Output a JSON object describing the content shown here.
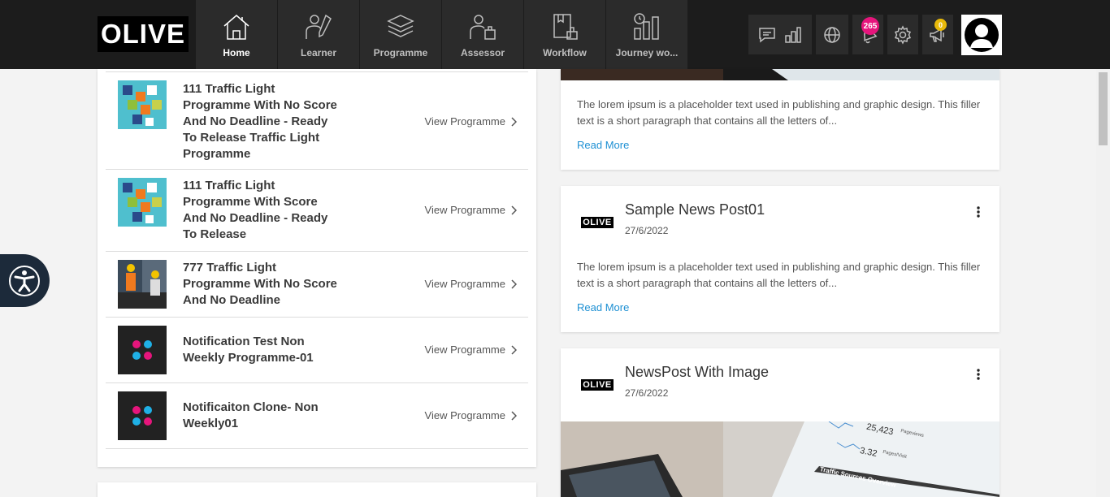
{
  "brand": {
    "logo_text": "OLIVE"
  },
  "nav": [
    {
      "label": "Home",
      "icon": "home-icon",
      "active": true
    },
    {
      "label": "Learner",
      "icon": "learner-icon",
      "active": false
    },
    {
      "label": "Programme",
      "icon": "programme-icon",
      "active": false
    },
    {
      "label": "Assessor",
      "icon": "assessor-icon",
      "active": false
    },
    {
      "label": "Workflow",
      "icon": "workflow-icon",
      "active": false
    },
    {
      "label": "Journey wo...",
      "icon": "journey-icon",
      "active": false
    }
  ],
  "tools": {
    "notifications_count": "265",
    "announcements_count": "0"
  },
  "programmes": [
    {
      "title": "111 Traffic Light Programme With No Score And No Deadline - Ready To Release Traffic Light Programme",
      "link": "View Programme",
      "thumb": "puzzle"
    },
    {
      "title": "111 Traffic Light Programme With Score And No Deadline - Ready To Release",
      "link": "View Programme",
      "thumb": "puzzle"
    },
    {
      "title": "777 Traffic Light Programme With No Score And No Deadline",
      "link": "View Programme",
      "thumb": "workers-photo"
    },
    {
      "title": "Notification Test Non Weekly Programme-01",
      "link": "View Programme",
      "thumb": "dots"
    },
    {
      "title": "Notificaiton Clone- Non Weekly01",
      "link": "View Programme",
      "thumb": "dots"
    }
  ],
  "news": {
    "card1": {
      "body": "The lorem ipsum is a placeholder text used in publishing and graphic design. This filler text is a short paragraph that contains all the letters of...",
      "read_more": "Read More"
    },
    "card2": {
      "logo": "OLIVE",
      "title": "Sample News Post01",
      "date": "27/6/2022",
      "body": "The lorem ipsum is a placeholder text used in publishing and graphic design. This filler text is a short paragraph that contains all the letters of...",
      "read_more": "Read More"
    },
    "card3": {
      "logo": "OLIVE",
      "title": "NewsPost With Image",
      "date": "27/6/2022",
      "image_text_1": "25,423",
      "image_text_1b": "Pageviews",
      "image_text_2": "3.32",
      "image_text_2b": "Pages/Visit",
      "image_text_3": "Traffic Sources Overview"
    }
  },
  "colors": {
    "accent_link": "#1e90d3",
    "badge_pink": "#e6157c",
    "badge_yellow": "#e8b909",
    "topbar": "#1c1c1c"
  }
}
